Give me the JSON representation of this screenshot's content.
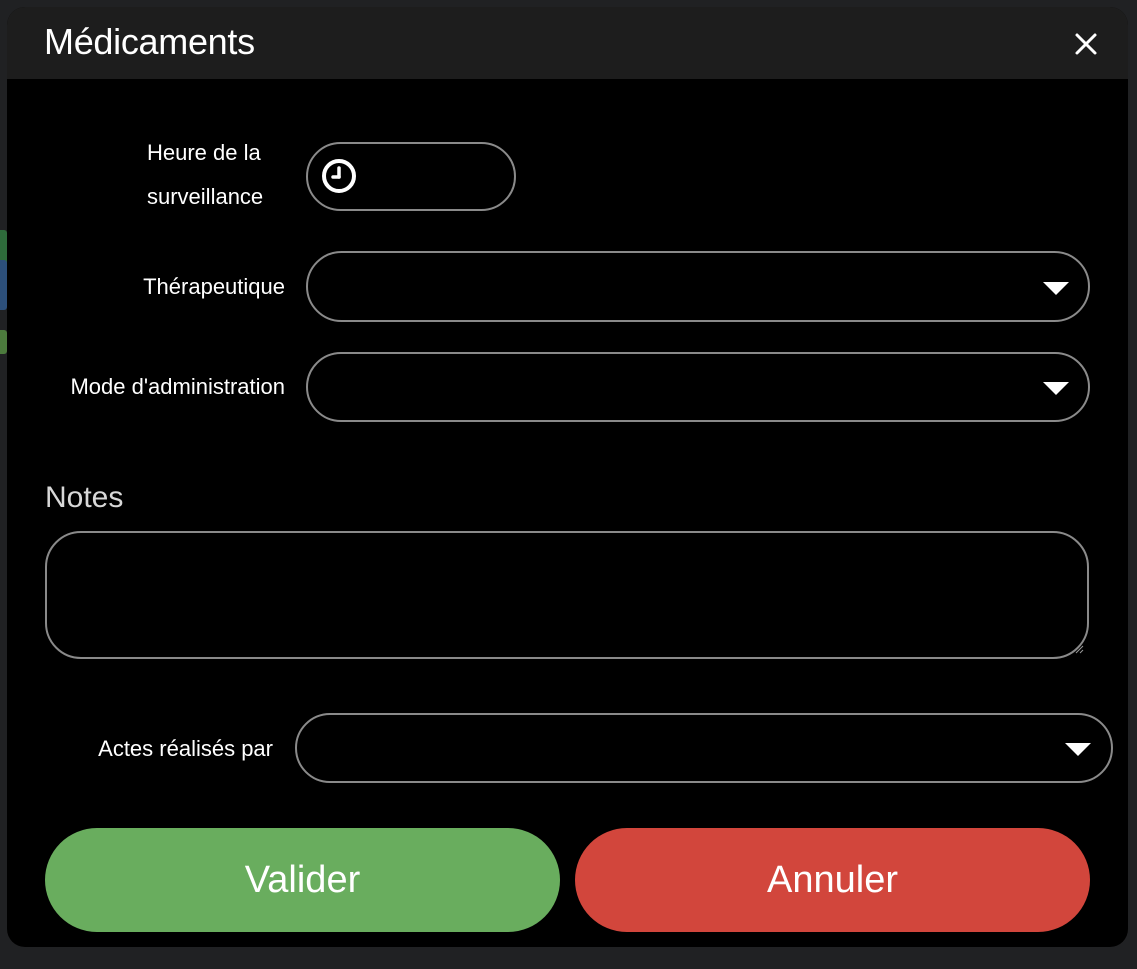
{
  "dialog": {
    "title": "Médicaments"
  },
  "fields": {
    "time_label_line1": "Heure de la",
    "time_label_line2": "surveillance",
    "time_value": "",
    "therapeutic_label": "Thérapeutique",
    "therapeutic_value": "",
    "admin_mode_label": "Mode d'administration",
    "admin_mode_value": "",
    "notes_label": "Notes",
    "notes_value": "",
    "performed_by_label": "Actes réalisés par",
    "performed_by_value": ""
  },
  "buttons": {
    "validate": "Valider",
    "cancel": "Annuler"
  },
  "colors": {
    "validate": "#69ad5e",
    "cancel": "#d2463c",
    "field_border": "#8a8a8a",
    "dialog_bg": "#000000",
    "titlebar_bg": "#1d1d1d"
  },
  "icons": {
    "close": "close-icon",
    "clock": "clock-icon",
    "dropdown": "chevron-down-icon"
  }
}
